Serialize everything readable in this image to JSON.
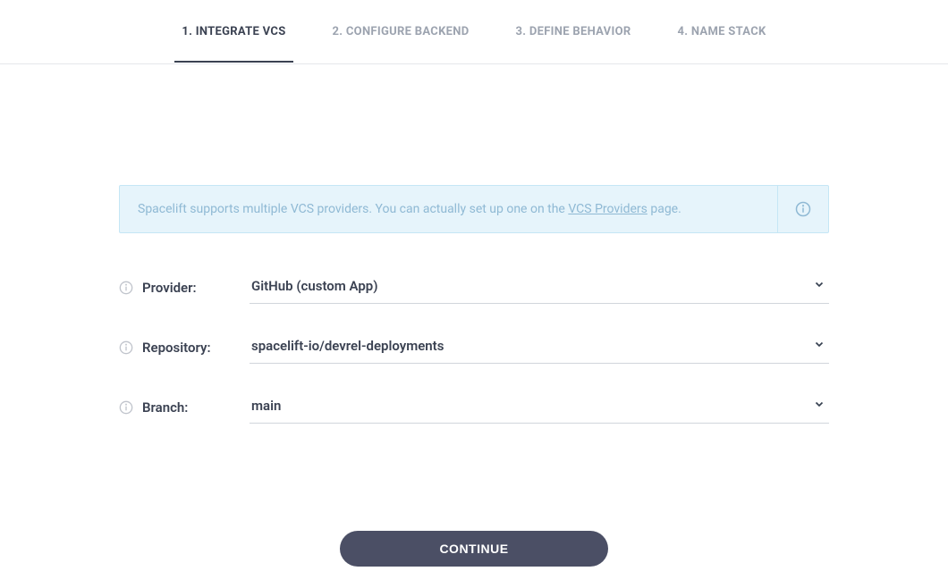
{
  "tabs": [
    {
      "label": "1. INTEGRATE VCS",
      "active": true
    },
    {
      "label": "2. CONFIGURE BACKEND",
      "active": false
    },
    {
      "label": "3. DEFINE BEHAVIOR",
      "active": false
    },
    {
      "label": "4. NAME STACK",
      "active": false
    }
  ],
  "banner": {
    "text_before": "Spacelift supports multiple VCS providers. You can actually set up one on the ",
    "link_text": "VCS Providers",
    "text_after": " page."
  },
  "fields": {
    "provider": {
      "label": "Provider:",
      "value": "GitHub (custom App)"
    },
    "repository": {
      "label": "Repository:",
      "value": "spacelift-io/devrel-deployments"
    },
    "branch": {
      "label": "Branch:",
      "value": "main"
    }
  },
  "continue_button": "CONTINUE"
}
